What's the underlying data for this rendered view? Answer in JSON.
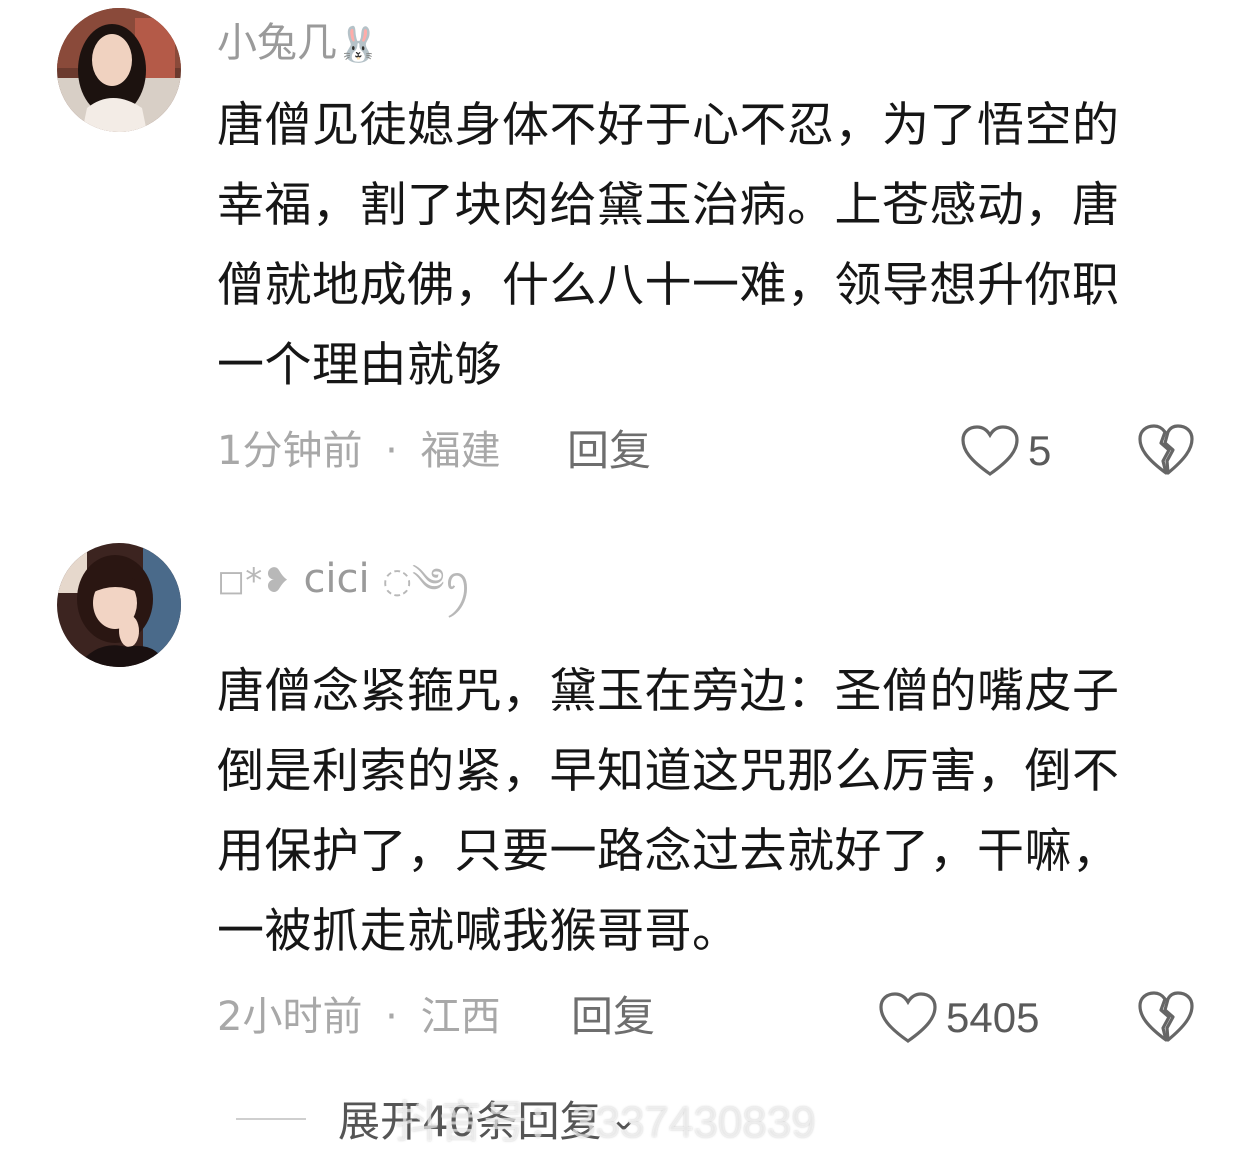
{
  "comments": [
    {
      "username": "小兔几",
      "username_suffix_icon": "rabbit-icon",
      "lines": [
        "唐僧见徒媳身体不好于心不忍，为了悟空的",
        "幸福，割了块肉给黛玉治病。上苍感动，唐",
        "僧就地成佛，什么八十一难，领导想升你职",
        "一个理由就够"
      ],
      "time": "1分钟前",
      "separator": "·",
      "location": "福建",
      "reply_label": "回复",
      "likes": "5"
    },
    {
      "username_prefix": "◻*❥",
      "username": "cici",
      "username_suffix": "◌༄ꪆ",
      "lines": [
        "唐僧念紧箍咒，黛玉在旁边：圣僧的嘴皮子",
        "倒是利索的紧，早知道这咒那么厉害，倒不",
        "用保护了，只要一路念过去就好了，干嘛，",
        "一被抓走就喊我猴哥哥。"
      ],
      "time": "2小时前",
      "separator": "·",
      "location": "江西",
      "reply_label": "回复",
      "likes": "5405"
    }
  ],
  "expand": {
    "label": "展开40条回复",
    "chevron": "⌄"
  },
  "watermark": "抖音号：3337430839",
  "colors": {
    "meta": "#a8a8a8",
    "username": "#9a9a9a",
    "text": "#161616",
    "reply": "#6e6e6e"
  }
}
